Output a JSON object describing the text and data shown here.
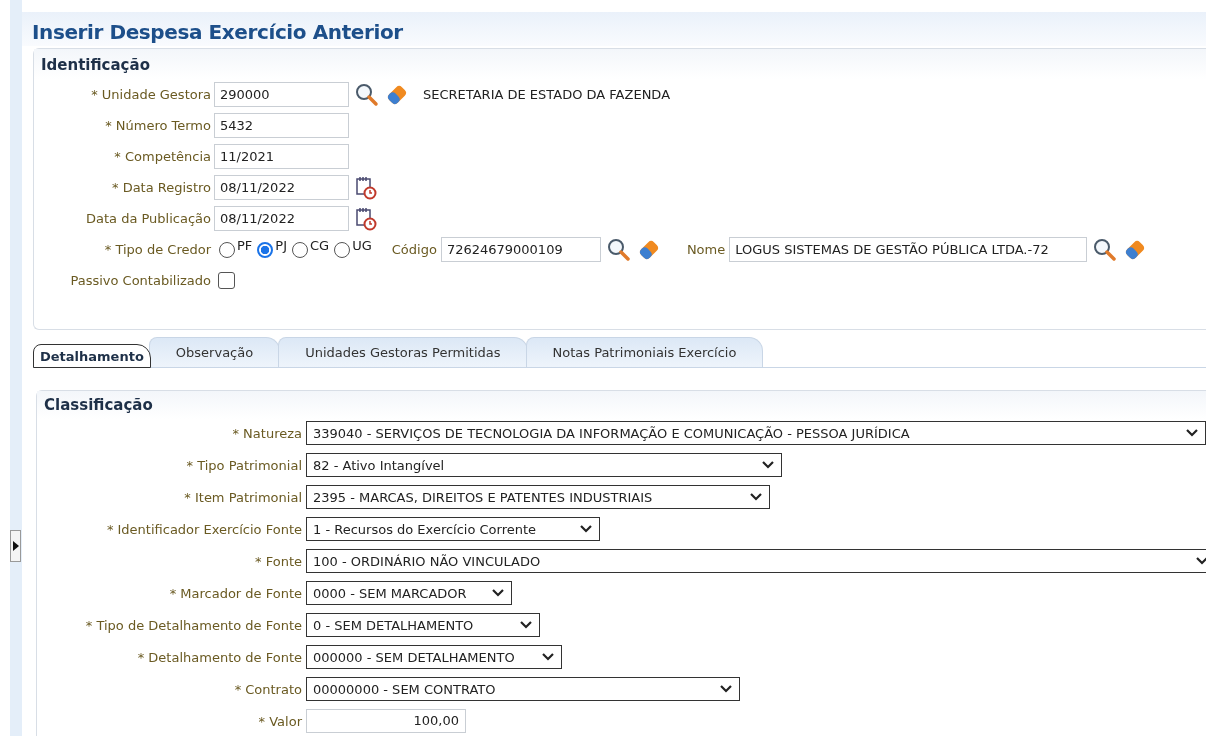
{
  "page_title": "Inserir Despesa Exercício Anterior",
  "identificacao": {
    "title": "Identificação",
    "unidade_gestora": {
      "label": "* Unidade Gestora",
      "value": "290000",
      "description": "SECRETARIA DE ESTADO DA FAZENDA"
    },
    "numero_termo": {
      "label": "* Número Termo",
      "value": "5432"
    },
    "competencia": {
      "label": "* Competência",
      "value": "11/2021"
    },
    "data_registro": {
      "label": "* Data Registro",
      "value": "08/11/2022"
    },
    "data_publicacao": {
      "label": "Data da Publicação",
      "value": "08/11/2022"
    },
    "tipo_credor": {
      "label": "* Tipo de Credor",
      "options": [
        {
          "label": "PF",
          "selected": false
        },
        {
          "label": "PJ",
          "selected": true
        },
        {
          "label": "CG",
          "selected": false
        },
        {
          "label": "UG",
          "selected": false
        }
      ]
    },
    "codigo": {
      "label": "Código",
      "value": "72624679000109"
    },
    "nome": {
      "label": "Nome",
      "value": "LOGUS SISTEMAS DE GESTÃO PÚBLICA LTDA.-72"
    },
    "passivo_contabilizado": {
      "label": "Passivo Contabilizado",
      "checked": false
    }
  },
  "tabs": [
    {
      "label": "Detalhamento",
      "selected": true
    },
    {
      "label": "Observação",
      "selected": false
    },
    {
      "label": "Unidades Gestoras Permitidas",
      "selected": false
    },
    {
      "label": "Notas Patrimoniais Exercício",
      "selected": false
    }
  ],
  "classificacao": {
    "title": "Classificação",
    "fields": [
      {
        "kind": "select",
        "label": "* Natureza",
        "value": "339040 - SERVIÇOS DE TECNOLOGIA DA INFORMAÇÃO E COMUNICAÇÃO - PESSOA JURÍDICA"
      },
      {
        "kind": "select",
        "label": "* Tipo Patrimonial",
        "value": "82 - Ativo Intangível"
      },
      {
        "kind": "select",
        "label": "* Item Patrimonial",
        "value": "2395 - MARCAS, DIREITOS E PATENTES INDUSTRIAIS"
      },
      {
        "kind": "select",
        "label": "* Identificador Exercício Fonte",
        "value": "1 - Recursos do Exercício Corrente"
      },
      {
        "kind": "select",
        "label": "* Fonte",
        "value": "100 - ORDINÁRIO NÃO VINCULADO"
      },
      {
        "kind": "select",
        "label": "* Marcador de Fonte",
        "value": "0000 - SEM MARCADOR"
      },
      {
        "kind": "select",
        "label": "* Tipo de Detalhamento de Fonte",
        "value": "0 - SEM DETALHAMENTO"
      },
      {
        "kind": "select",
        "label": "* Detalhamento de Fonte",
        "value": "000000 - SEM DETALHAMENTO"
      },
      {
        "kind": "select",
        "label": "* Contrato",
        "value": "00000000 - SEM CONTRATO"
      },
      {
        "kind": "number",
        "label": "* Valor",
        "value": "100,00"
      }
    ]
  }
}
